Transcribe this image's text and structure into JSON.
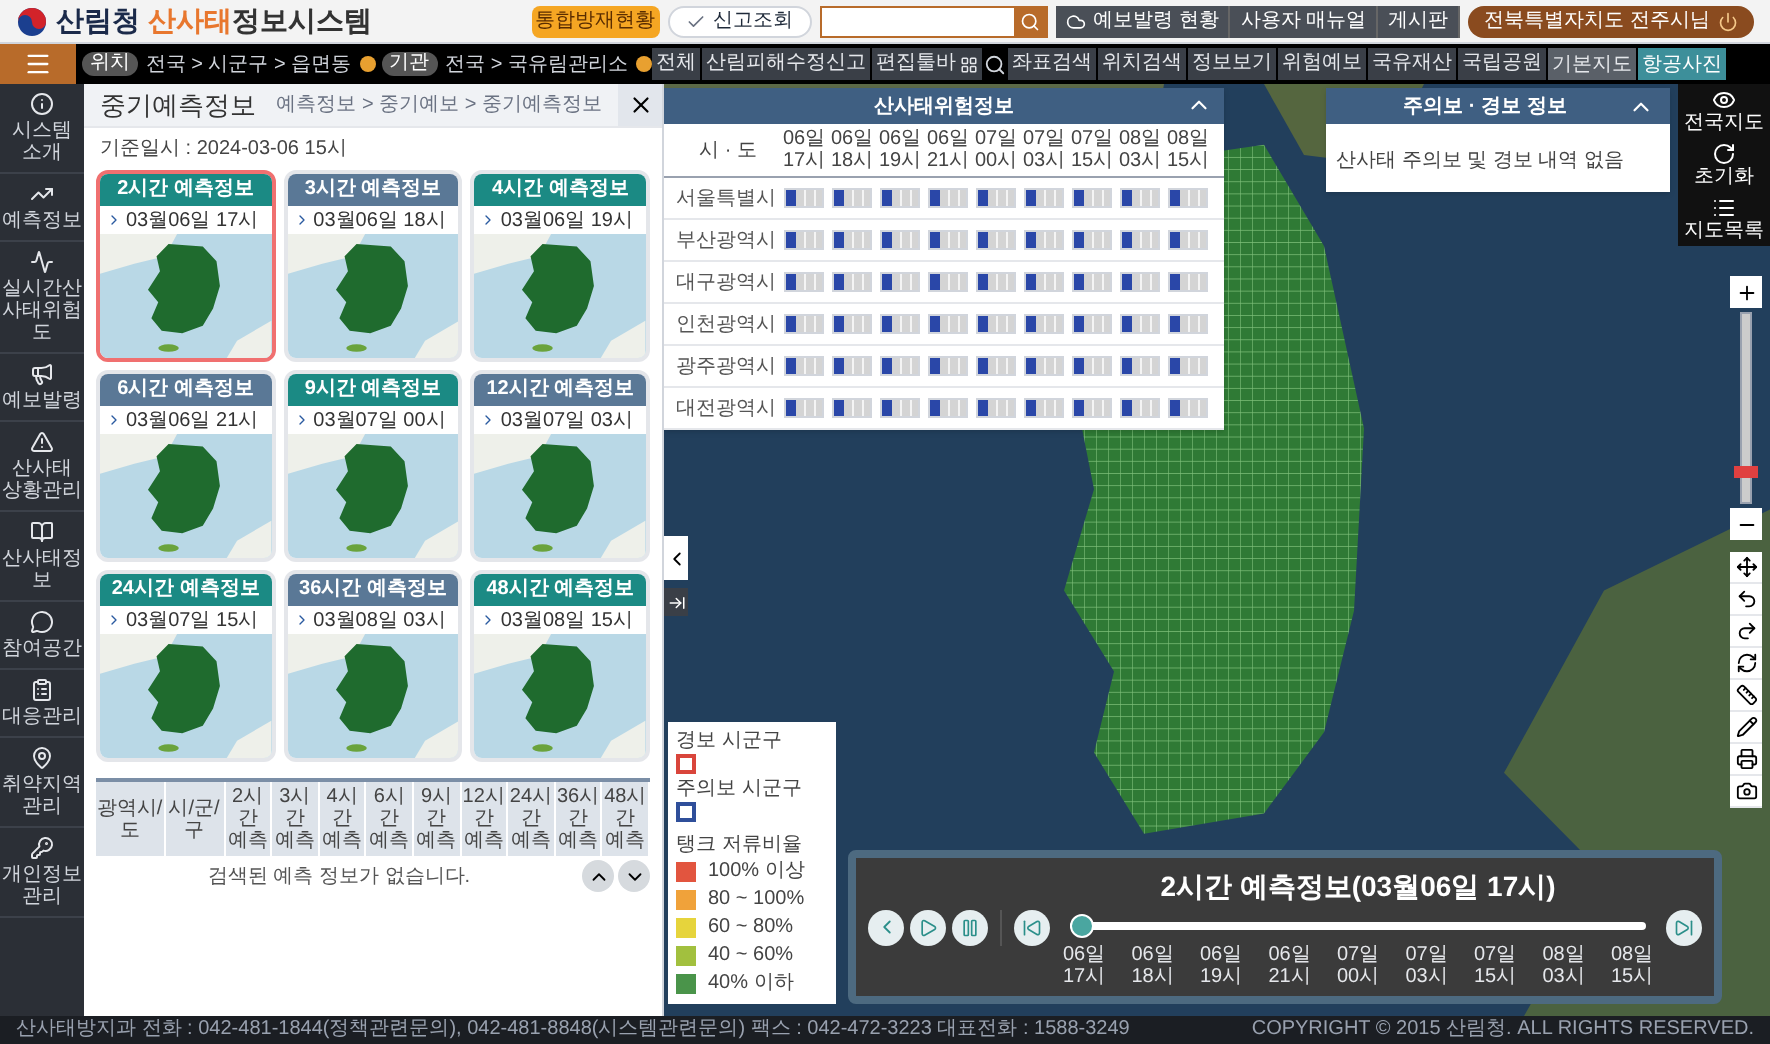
{
  "header": {
    "org": "산림청",
    "title_accent": "산사태",
    "title_rest": "정보시스템",
    "status_button": "통합방재현황",
    "report_toggle": {
      "label": "신고조회",
      "checked": true
    },
    "links": [
      "예보발령 현황",
      "사용자 매뉴얼",
      "게시판"
    ],
    "user": "전북특별자치도 전주시님"
  },
  "toolbar": {
    "location": {
      "tag": "위치",
      "path": "전국 > 시군구 > 읍면동"
    },
    "agency": {
      "tag": "기관",
      "path": "전국 > 국유림관리소"
    },
    "actions": [
      "전체",
      "산림피해수정신고"
    ],
    "edit_toggle": "편집툴바",
    "tools": [
      "좌표검색",
      "위치검색",
      "정보보기",
      "위험예보",
      "국유재산",
      "국립공원"
    ],
    "basemaps": [
      {
        "label": "기본지도",
        "selected": false
      },
      {
        "label": "항공사진",
        "selected": true
      }
    ],
    "view_buttons": [
      "전국지도",
      "초기화",
      "지도목록"
    ]
  },
  "sidebar": {
    "items": [
      "시스템 소개",
      "예측정보",
      "실시간산사태위험도",
      "예보발령",
      "산사태 상황관리",
      "산사태정보",
      "참여공간",
      "대응관리",
      "취약지역 관리",
      "개인정보 관리"
    ]
  },
  "panel": {
    "title": "중기예측정보",
    "breadcrumb": "예측정보 > 중기예보 > 중기예측정보",
    "base_time": "기준일시 : 2024-03-06 15시",
    "cards": [
      {
        "title": "2시간 예측정보",
        "time": "03월06일 17시",
        "color": "#1b8a84",
        "selected": true
      },
      {
        "title": "3시간 예측정보",
        "time": "03월06일 18시",
        "color": "#5a7896",
        "selected": false
      },
      {
        "title": "4시간 예측정보",
        "time": "03월06일 19시",
        "color": "#1b8a84",
        "selected": false
      },
      {
        "title": "6시간 예측정보",
        "time": "03월06일 21시",
        "color": "#5a7896",
        "selected": false
      },
      {
        "title": "9시간 예측정보",
        "time": "03월07일 00시",
        "color": "#1b8a84",
        "selected": false
      },
      {
        "title": "12시간 예측정보",
        "time": "03월07일 03시",
        "color": "#5a7896",
        "selected": false
      },
      {
        "title": "24시간 예측정보",
        "time": "03월07일 15시",
        "color": "#1b8a84",
        "selected": false
      },
      {
        "title": "36시간 예측정보",
        "time": "03월08일 03시",
        "color": "#5a7896",
        "selected": false
      },
      {
        "title": "48시간 예측정보",
        "time": "03월08일 15시",
        "color": "#1b8a84",
        "selected": false
      }
    ],
    "table": {
      "columns": [
        "광역시/도",
        "시/군/구",
        "2시간 예측",
        "3시간 예측",
        "4시간 예측",
        "6시간 예측",
        "9시간 예측",
        "12시간 예측",
        "24시간 예측",
        "36시간 예측",
        "48시간 예측"
      ],
      "empty_message": "검색된 예측 정보가 없습니다."
    }
  },
  "risk_popup": {
    "title": "산사태위험정보",
    "columns": [
      "시 · 도",
      "06일 17시",
      "06일 18시",
      "06일 19시",
      "06일 21시",
      "07일 00시",
      "07일 03시",
      "07일 15시",
      "08일 03시",
      "08일 15시"
    ],
    "rows": [
      {
        "region": "서울특별시",
        "cells": [
          {
            "level": 0.25
          },
          {
            "level": 0.25
          },
          {
            "level": 0.25
          },
          {
            "level": 0.25
          },
          {
            "level": 0.25
          },
          {
            "level": 0.25
          },
          {
            "level": 0.25
          },
          {
            "level": 0.25
          },
          {
            "level": 0.25
          }
        ]
      },
      {
        "region": "부산광역시",
        "cells": [
          {
            "level": 0.25
          },
          {
            "level": 0.25
          },
          {
            "level": 0.25
          },
          {
            "level": 0.25
          },
          {
            "level": 0.25
          },
          {
            "level": 0.25
          },
          {
            "level": 0.25
          },
          {
            "level": 0.25
          },
          {
            "level": 0.25
          }
        ]
      },
      {
        "region": "대구광역시",
        "cells": [
          {
            "level": 0.25
          },
          {
            "level": 0.25
          },
          {
            "level": 0.25
          },
          {
            "level": 0.25
          },
          {
            "level": 0.25
          },
          {
            "level": 0.25
          },
          {
            "level": 0.25
          },
          {
            "level": 0.25
          },
          {
            "level": 0.25
          }
        ]
      },
      {
        "region": "인천광역시",
        "cells": [
          {
            "level": 0.25
          },
          {
            "level": 0.25
          },
          {
            "level": 0.25
          },
          {
            "level": 0.25
          },
          {
            "level": 0.25
          },
          {
            "level": 0.25
          },
          {
            "level": 0.25
          },
          {
            "level": 0.25
          },
          {
            "level": 0.25
          }
        ]
      },
      {
        "region": "광주광역시",
        "cells": [
          {
            "level": 0.25
          },
          {
            "level": 0.25
          },
          {
            "level": 0.25
          },
          {
            "level": 0.25
          },
          {
            "level": 0.25
          },
          {
            "level": 0.25
          },
          {
            "level": 0.25
          },
          {
            "level": 0.25
          },
          {
            "level": 0.25
          }
        ]
      },
      {
        "region": "대전광역시",
        "cells": [
          {
            "level": 0.25
          },
          {
            "level": 0.25
          },
          {
            "level": 0.25
          },
          {
            "level": 0.25
          },
          {
            "level": 0.25
          },
          {
            "level": 0.25
          },
          {
            "level": 0.25
          },
          {
            "level": 0.25
          },
          {
            "level": 0.25
          }
        ]
      }
    ]
  },
  "warning_popup": {
    "title": "주의보 · 경보 정보",
    "message": "산사태 주의보 및 경보 내역 없음"
  },
  "legend": {
    "outline_items": [
      {
        "label": "경보 시군구",
        "color": "#d9453b"
      },
      {
        "label": "주의보 시군구",
        "color": "#2f4f9a"
      }
    ],
    "ratio_title": "탱크 저류비율",
    "ratio_items": [
      {
        "label": "100% 이상",
        "color": "#e2553f"
      },
      {
        "label": "80 ~ 100%",
        "color": "#f0a23a"
      },
      {
        "label": "60 ~ 80%",
        "color": "#e6d43c"
      },
      {
        "label": "40 ~ 60%",
        "color": "#a2c03e"
      },
      {
        "label": "40% 이하",
        "color": "#4a944a"
      }
    ]
  },
  "player": {
    "title": "2시간 예측정보(03월06일 17시)",
    "level": 0,
    "ticks": [
      "06일 17시",
      "06일 18시",
      "06일 19시",
      "06일 21시",
      "07일 00시",
      "07일 03시",
      "07일 15시",
      "08일 03시",
      "08일 15시"
    ]
  },
  "map_zoom": {
    "level": 0.15
  },
  "footer": {
    "contact": "산사태방지과 전화 : 042-481-1844(정책관련문의), 042-481-8848(시스템관련문의) 팩스 : 042-472-3223 대표전화 : 1588-3249",
    "copyright": "COPYRIGHT © 2015 산림청. ALL RIGHTS RESERVED."
  }
}
